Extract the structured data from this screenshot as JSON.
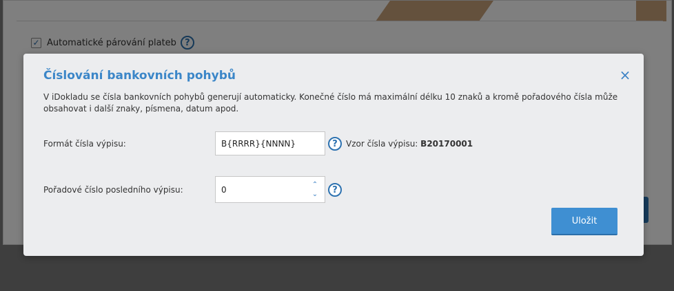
{
  "background": {
    "auto_pairing_label": "Automatické párování plateb",
    "auto_pairing_checked": true
  },
  "icons": {
    "help": "?",
    "close": "×",
    "check": "✓",
    "stepper_up": "⌃",
    "stepper_down": "⌄"
  },
  "modal": {
    "title": "Číslování bankovních pohybů",
    "description": "V iDokladu se čísla bankovních pohybů generují automaticky. Konečné číslo má maximální délku 10 znaků a kromě pořadového čísla může obsahovat i další znaky, písmena, datum apod.",
    "format_label": "Formát čísla výpisu:",
    "format_value": "B{RRRR}{NNNN}",
    "example_label": "Vzor čísla výpisu:",
    "example_value": "B20170001",
    "order_label": "Pořadové číslo posledního výpisu:",
    "order_value": "0",
    "save_label": "Uložit"
  },
  "colors": {
    "accent": "#3b86c8",
    "button": "#3f8fd2",
    "modal_bg": "#ecedef"
  }
}
